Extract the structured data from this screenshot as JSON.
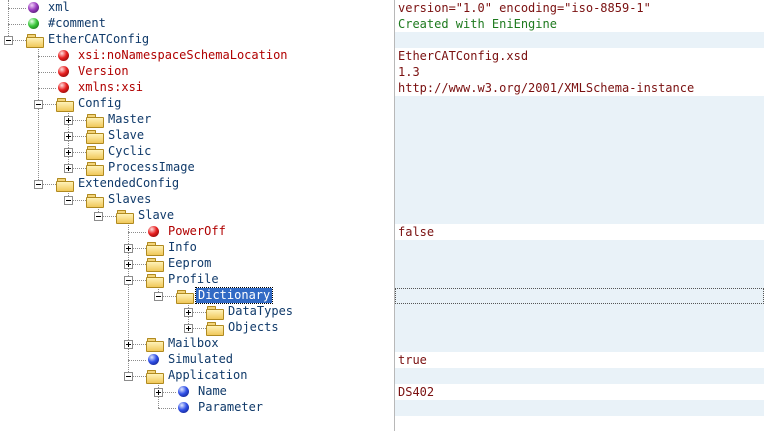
{
  "tree": {
    "nodes": [
      {
        "label": "xml",
        "icon": "purple-node-icon",
        "kind": "element"
      },
      {
        "label": "#comment",
        "icon": "green-node-icon",
        "kind": "element"
      },
      {
        "label": "EtherCATConfig",
        "icon": "folder-icon",
        "kind": "element"
      },
      {
        "label": "xsi:noNamespaceSchemaLocation",
        "icon": "red-node-icon",
        "kind": "attr"
      },
      {
        "label": "Version",
        "icon": "red-node-icon",
        "kind": "attr"
      },
      {
        "label": "xmlns:xsi",
        "icon": "red-node-icon",
        "kind": "attr"
      },
      {
        "label": "Config",
        "icon": "folder-icon",
        "kind": "element"
      },
      {
        "label": "Master",
        "icon": "folder-icon",
        "kind": "element"
      },
      {
        "label": "Slave",
        "icon": "folder-icon",
        "kind": "element"
      },
      {
        "label": "Cyclic",
        "icon": "folder-icon",
        "kind": "element"
      },
      {
        "label": "ProcessImage",
        "icon": "folder-icon",
        "kind": "element"
      },
      {
        "label": "ExtendedConfig",
        "icon": "folder-icon",
        "kind": "element"
      },
      {
        "label": "Slaves",
        "icon": "folder-icon",
        "kind": "element"
      },
      {
        "label": "Slave",
        "icon": "folder-icon",
        "kind": "element"
      },
      {
        "label": "PowerOff",
        "icon": "red-node-icon",
        "kind": "attr"
      },
      {
        "label": "Info",
        "icon": "folder-icon",
        "kind": "element"
      },
      {
        "label": "Eeprom",
        "icon": "folder-icon",
        "kind": "element"
      },
      {
        "label": "Profile",
        "icon": "folder-icon",
        "kind": "element"
      },
      {
        "label": "Dictionary",
        "icon": "folder-icon",
        "kind": "element",
        "selected": true
      },
      {
        "label": "DataTypes",
        "icon": "folder-icon",
        "kind": "element"
      },
      {
        "label": "Objects",
        "icon": "folder-icon",
        "kind": "element"
      },
      {
        "label": "Mailbox",
        "icon": "folder-icon",
        "kind": "element"
      },
      {
        "label": "Simulated",
        "icon": "blue-node-icon",
        "kind": "element"
      },
      {
        "label": "Application",
        "icon": "folder-icon",
        "kind": "element"
      },
      {
        "label": "Name",
        "icon": "blue-node-icon",
        "kind": "element"
      },
      {
        "label": "Parameter",
        "icon": "blue-node-icon",
        "kind": "element"
      }
    ]
  },
  "values": [
    "version=\"1.0\" encoding=\"iso-8859-1\"",
    "Created with EniEngine",
    "",
    "EtherCATConfig.xsd",
    "1.3",
    "http://www.w3.org/2001/XMLSchema-instance",
    "",
    "",
    "",
    "",
    "",
    "",
    "",
    "",
    "false",
    "",
    "",
    "",
    "",
    "",
    "",
    "",
    "true",
    "",
    "DS402",
    ""
  ],
  "colors": {
    "element_text": "#103a6a",
    "attr_text": "#b00000",
    "value_text": "#7a1010",
    "comment_text": "#1e7a1e",
    "selection": "#316ac5",
    "value_shade": "#e9f2f8"
  }
}
